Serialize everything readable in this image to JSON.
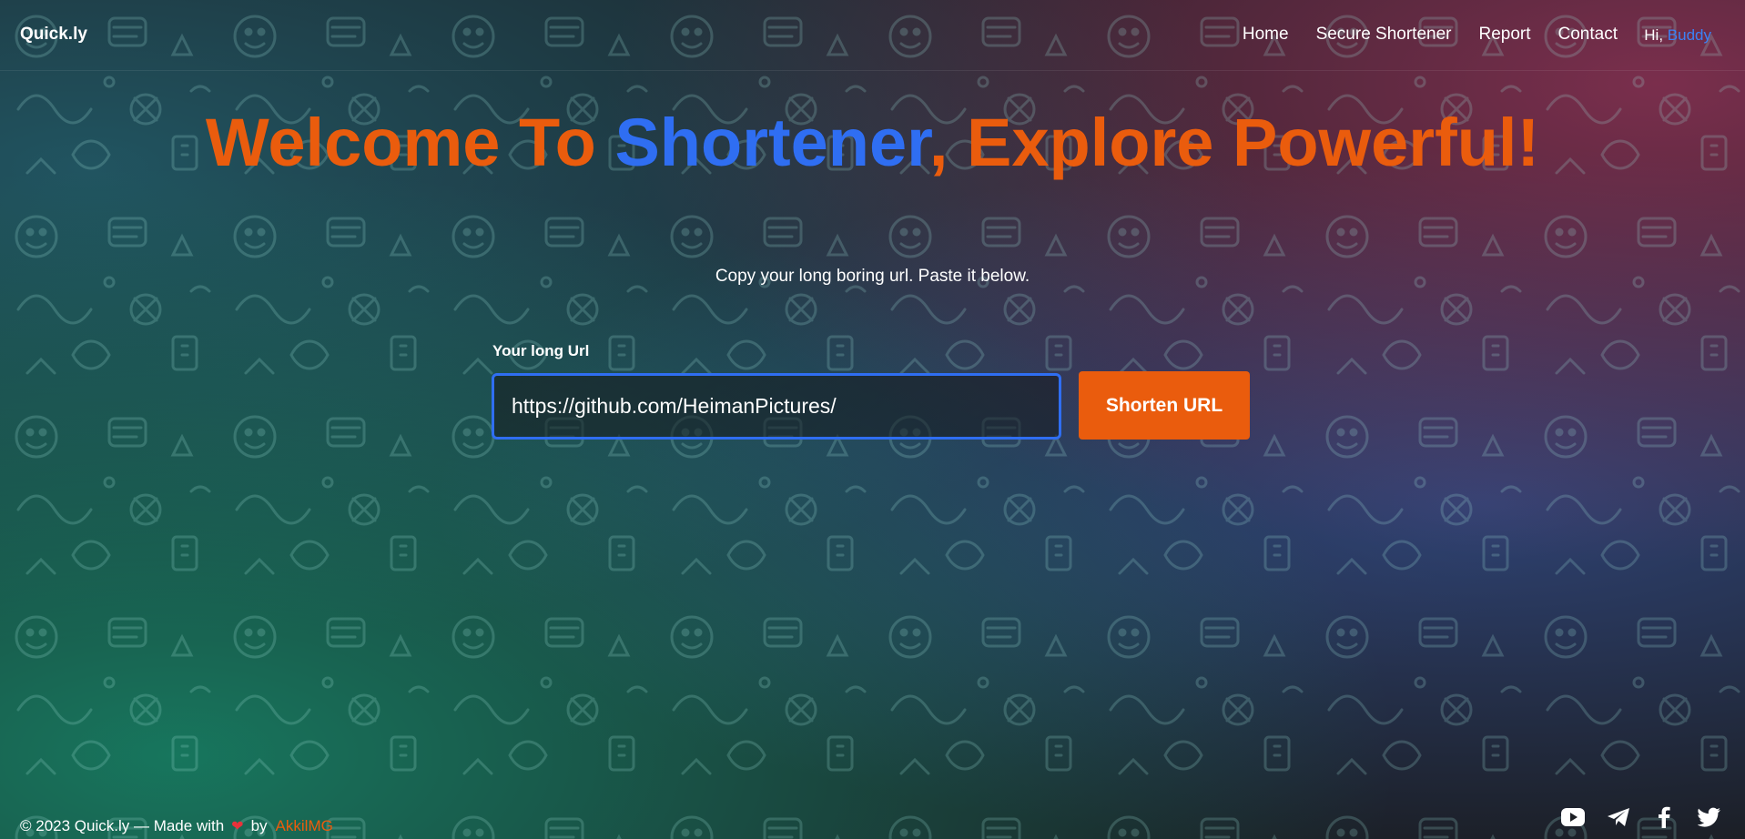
{
  "navbar": {
    "brand": "Quick.ly",
    "links": [
      "Home",
      "Secure Shortener",
      "Report",
      "Contact"
    ],
    "greeting_prefix": "Hi,",
    "user_name": "Buddy"
  },
  "hero": {
    "title_part1": "Welcome To ",
    "title_accent": "Shortener",
    "title_part2": ", Explore Powerful!",
    "subtitle": "Copy your long boring url. Paste it below."
  },
  "form": {
    "label": "Your long Url",
    "input_value": "https://github.com/HeimanPictures/",
    "button_label": "Shorten URL"
  },
  "footer": {
    "text": "© 2023 Quick.ly — Made with",
    "heart": "❤",
    "by": "by",
    "author": "AkkilMG"
  },
  "social": {
    "icons": [
      "youtube-icon",
      "telegram-icon",
      "facebook-icon",
      "twitter-icon"
    ]
  },
  "colors": {
    "accent_orange": "#ea5c0d",
    "accent_blue": "#2f6ef2",
    "background": "#1b1e24"
  }
}
